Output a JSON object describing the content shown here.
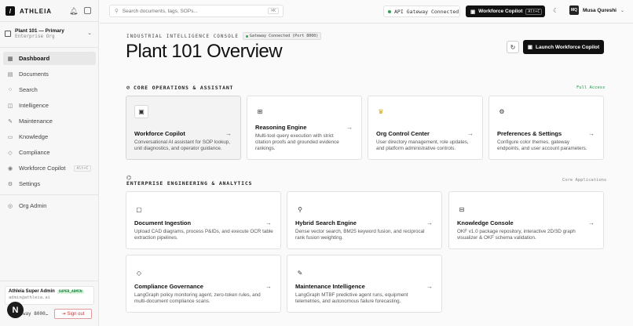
{
  "sidebar": {
    "brand": "ATHLEIA",
    "org_title": "Plant 101 — Primary",
    "org_sub": "Enterprise Org",
    "items": [
      {
        "label": "Dashboard",
        "icon": "dashboard-icon"
      },
      {
        "label": "Documents",
        "icon": "document-icon"
      },
      {
        "label": "Search",
        "icon": "search-icon"
      },
      {
        "label": "Intelligence",
        "icon": "intelligence-icon"
      },
      {
        "label": "Maintenance",
        "icon": "wrench-icon"
      },
      {
        "label": "Knowledge",
        "icon": "knowledge-icon"
      },
      {
        "label": "Compliance",
        "icon": "shield-icon"
      },
      {
        "label": "Workforce Copilot",
        "icon": "bot-icon",
        "kbd": "Alt+C"
      },
      {
        "label": "Settings",
        "icon": "gear-icon"
      }
    ],
    "org_admin": "Org Admin",
    "profile_name": "Athleia Super Admin",
    "profile_badge": "SUPER_ADMIN",
    "profile_email": "admin@athleia.ai",
    "gateway_mini": "ateway 8000…",
    "sign_out": "Sign out",
    "avatar_letter": "N"
  },
  "topbar": {
    "search_placeholder": "Search documents, tags, SOPs...",
    "search_kbd": "⌘K",
    "api_status": "API Gateway Connected",
    "copilot_label": "Workforce Copilot",
    "copilot_kbd": "Alt+C",
    "user_initials": "MQ",
    "user_name": "Musa Qureshi"
  },
  "header": {
    "kicker": "INDUSTRIAL INTELLIGENCE CONSOLE",
    "gateway_badge": "Gateway Connected (Port 8000)",
    "title": "Plant 101 Overview",
    "launch_label": "Launch Workforce Copilot"
  },
  "core": {
    "heading": "CORE OPERATIONS & ASSISTANT",
    "right_label": "Full Access",
    "right_color": "#1a9e4b",
    "cards": [
      {
        "title": "Workforce Copilot",
        "desc": [
          "Conversational AI assistant for SOP lookup,",
          "unit diagnostics, and operator guidance."
        ]
      },
      {
        "title": "Reasoning Engine",
        "desc": [
          "Multi-tool query execution with strict",
          "citation proofs and grounded evidence",
          "rankings."
        ]
      },
      {
        "title": "Org Control Center",
        "desc": [
          "User directory management, role updates,",
          "and platform administrative controls."
        ]
      },
      {
        "title": "Preferences & Settings",
        "desc": [
          "Configure color themes, gateway",
          "endpoints, and user account parameters."
        ]
      }
    ]
  },
  "eng": {
    "heading": "ENTERPRISE ENGINEERING & ANALYTICS",
    "right_label": "Core Applications",
    "right_color": "#888888",
    "cards": [
      {
        "title": "Document Ingestion",
        "desc": [
          "Upload CAD diagrams, process P&IDs, and execute OCR table",
          "extraction pipelines."
        ]
      },
      {
        "title": "Hybrid Search Engine",
        "desc": [
          "Dense vector search, BM25 keyword fusion, and reciprocal",
          "rank fusion weighting."
        ]
      },
      {
        "title": "Knowledge Console",
        "desc": [
          "OKF v1.0 package repository, interactive 2D/3D graph",
          "visualizer & OKF schema validation."
        ]
      },
      {
        "title": "Compliance Governance",
        "desc": [
          "LangGraph policy monitoring agent, zero-token rules, and",
          "multi-document compliance scans."
        ]
      },
      {
        "title": "Maintenance Intelligence",
        "desc": [
          "LangGraph MTBF predictive agent runs, equipment",
          "telemetries, and autonomous failure forecasting."
        ]
      }
    ]
  }
}
